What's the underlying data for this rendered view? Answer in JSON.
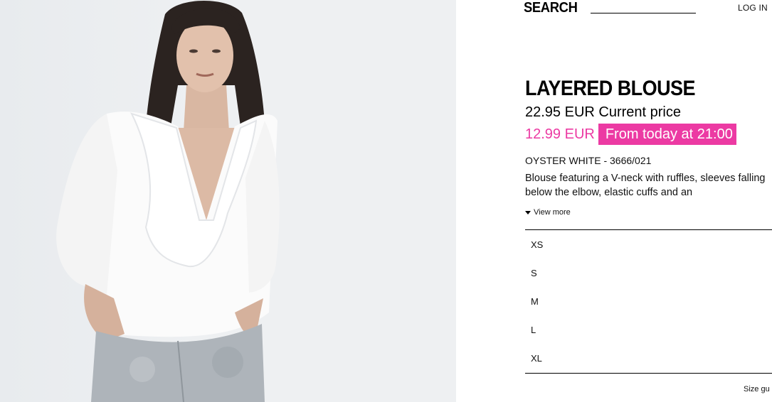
{
  "header": {
    "search_label": "SEARCH",
    "login_label": "LOG IN"
  },
  "product": {
    "title": "LAYERED BLOUSE",
    "current_price_text": "22.95 EUR Current price",
    "sale_price": "12.99 EUR",
    "promo_label": "From today at 21:00",
    "color_ref": "OYSTER WHITE - 3666/021",
    "description": "Blouse featuring a V-neck with ruffles, sleeves falling below the elbow, elastic cuffs and an",
    "view_more_label": "View more",
    "sizes": [
      "XS",
      "S",
      "M",
      "L",
      "XL"
    ],
    "size_guide_label": "Size gu"
  },
  "colors": {
    "accent_pink": "#ec3aa3",
    "image_background": "#eceef0"
  }
}
